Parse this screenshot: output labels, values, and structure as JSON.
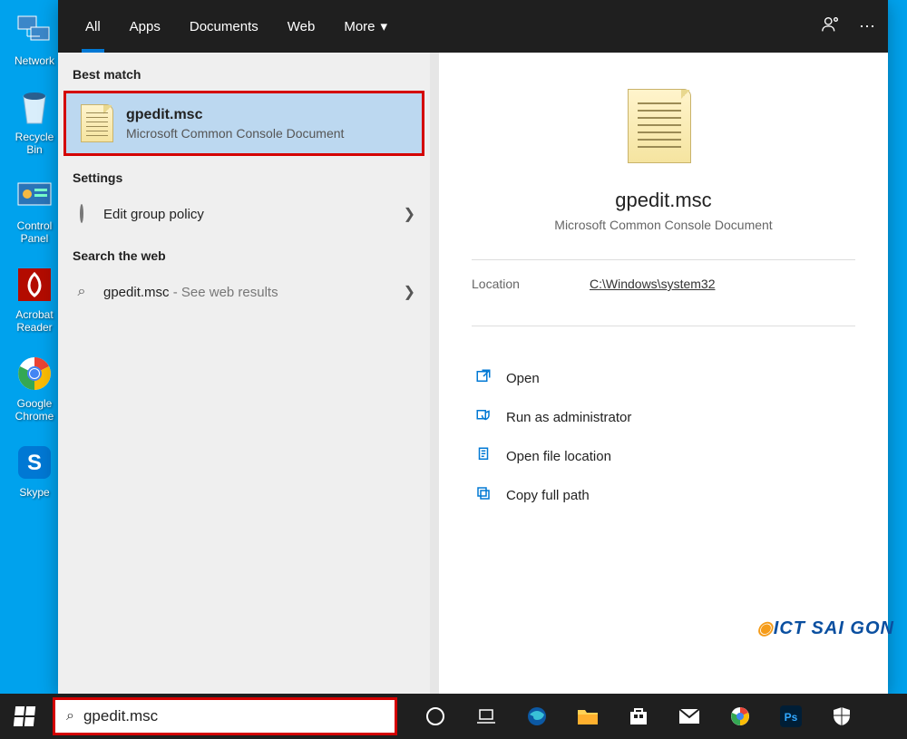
{
  "desktop": {
    "icons": [
      {
        "label": "Network"
      },
      {
        "label": "Recycle Bin"
      },
      {
        "label": "Control Panel"
      },
      {
        "label": "Acrobat Reader"
      },
      {
        "label": "Google Chrome"
      },
      {
        "label": "Skype"
      }
    ]
  },
  "tabs": {
    "items": [
      "All",
      "Apps",
      "Documents",
      "Web",
      "More"
    ],
    "active": 0
  },
  "sections": {
    "best_match": "Best match",
    "settings": "Settings",
    "web": "Search the web"
  },
  "best_match": {
    "title": "gpedit.msc",
    "subtitle": "Microsoft Common Console Document"
  },
  "settings_items": [
    {
      "label": "Edit group policy"
    }
  ],
  "web_items": [
    {
      "prefix": "gpedit.msc",
      "suffix": " - See web results"
    }
  ],
  "preview": {
    "title": "gpedit.msc",
    "subtitle": "Microsoft Common Console Document",
    "location_label": "Location",
    "location_value": "C:\\Windows\\system32"
  },
  "actions": [
    {
      "icon": "open",
      "label": "Open"
    },
    {
      "icon": "admin",
      "label": "Run as administrator"
    },
    {
      "icon": "folder",
      "label": "Open file location"
    },
    {
      "icon": "copy",
      "label": "Copy full path"
    }
  ],
  "searchbox": {
    "value": "gpedit.msc"
  },
  "watermark": "ICT SAI GON"
}
